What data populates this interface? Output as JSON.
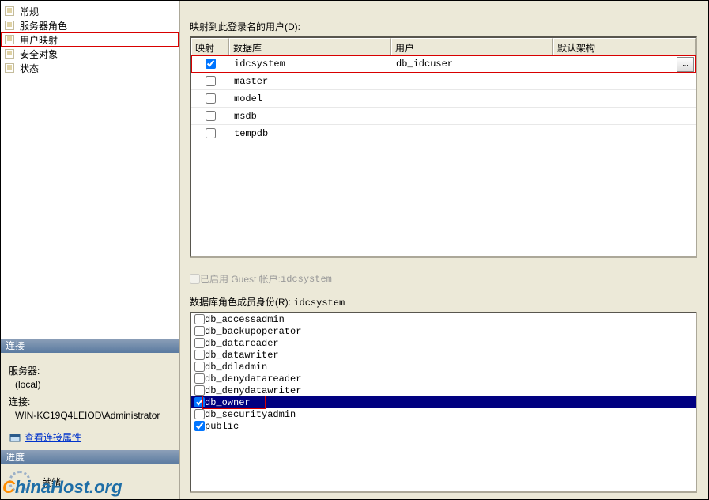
{
  "tree": {
    "items": [
      {
        "label": "常规",
        "selected": false
      },
      {
        "label": "服务器角色",
        "selected": false
      },
      {
        "label": "用户映射",
        "selected": true
      },
      {
        "label": "安全对象",
        "selected": false
      },
      {
        "label": "状态",
        "selected": false
      }
    ]
  },
  "mapping": {
    "title": "映射到此登录名的用户(D):",
    "headers": {
      "map": "映射",
      "db": "数据库",
      "user": "用户",
      "schema": "默认架构"
    },
    "rows": [
      {
        "checked": true,
        "db": "idcsystem",
        "user": "db_idcuser",
        "schema": "",
        "highlight": true
      },
      {
        "checked": false,
        "db": "master",
        "user": "",
        "schema": ""
      },
      {
        "checked": false,
        "db": "model",
        "user": "",
        "schema": ""
      },
      {
        "checked": false,
        "db": "msdb",
        "user": "",
        "schema": ""
      },
      {
        "checked": false,
        "db": "tempdb",
        "user": "",
        "schema": ""
      }
    ]
  },
  "guest": {
    "label_prefix": "已启用 Guest 帐户: ",
    "label_value": "idcsystem"
  },
  "roles": {
    "title_prefix": "数据库角色成员身份(R): ",
    "title_value": "idcsystem",
    "items": [
      {
        "name": "db_accessadmin",
        "checked": false
      },
      {
        "name": "db_backupoperator",
        "checked": false
      },
      {
        "name": "db_datareader",
        "checked": false
      },
      {
        "name": "db_datawriter",
        "checked": false
      },
      {
        "name": "db_ddladmin",
        "checked": false
      },
      {
        "name": "db_denydatareader",
        "checked": false
      },
      {
        "name": "db_denydatawriter",
        "checked": false
      },
      {
        "name": "db_owner",
        "checked": true,
        "selected": true,
        "highlight": true
      },
      {
        "name": "db_securityadmin",
        "checked": false
      },
      {
        "name": "public",
        "checked": true
      }
    ]
  },
  "connection": {
    "header": "连接",
    "server_label": "服务器:",
    "server_value": "(local)",
    "conn_label": "连接:",
    "conn_value": "WIN-KC19Q4LEIOD\\Administrator",
    "link": "查看连接属性"
  },
  "progress": {
    "header": "进度",
    "status": "就绪"
  },
  "logo": {
    "text_c": "C",
    "text_rest": "hinaHost.org"
  }
}
